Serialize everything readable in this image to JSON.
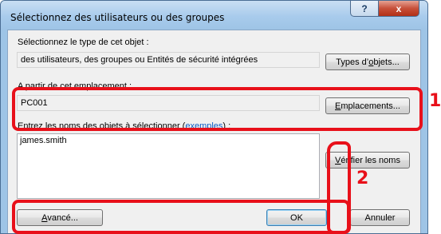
{
  "window": {
    "title": "Sélectionnez des utilisateurs ou des groupes",
    "help_label": "?",
    "close_label": "x"
  },
  "object_type": {
    "label": "Sélectionnez le type de cet objet :",
    "value": "des utilisateurs, des groupes ou Entités de sécurité intégrées",
    "button_pre": "Types d",
    "button_u": "o",
    "button_post": "bjets..."
  },
  "location": {
    "label": "A partir de cet emplacement :",
    "value": "PC001",
    "button_u": "E",
    "button_post": "mplacements..."
  },
  "names": {
    "label_prefix": "Entrez les noms des objets à sélectionner (",
    "label_link": "exemples",
    "label_suffix": ") :",
    "value": "james.smith",
    "check_button_u": "V",
    "check_button_post": "érifier les noms"
  },
  "footer": {
    "advanced_u": "A",
    "advanced_post": "vancé...",
    "ok_label": "OK",
    "cancel_label": "Annuler"
  },
  "callouts": [
    "1",
    "2"
  ],
  "colors": {
    "highlight": "#e8101a",
    "link": "#0a5bc4",
    "title_bar": "#9ec4e6"
  }
}
